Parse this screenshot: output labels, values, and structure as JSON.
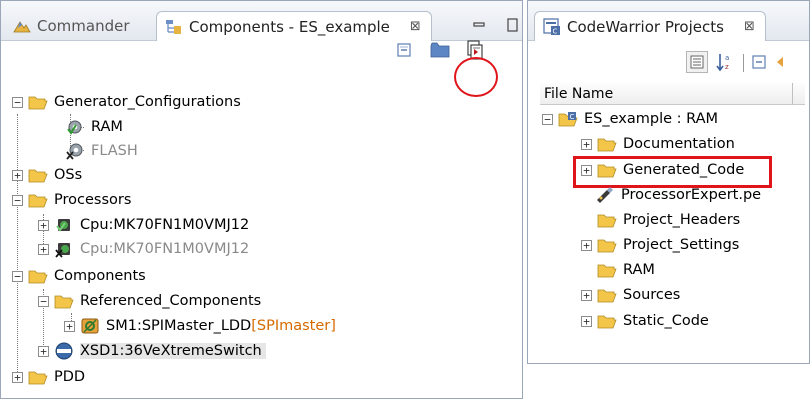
{
  "left_view": {
    "tabs": [
      {
        "label": "Commander",
        "active": false
      },
      {
        "label": "Components - ES_example",
        "active": true
      }
    ],
    "close_glyph": "⊠"
  },
  "right_view": {
    "tab": {
      "label": "CodeWarrior Projects",
      "active": true
    },
    "close_glyph": "⊠",
    "column_header": "File Name"
  },
  "components_tree": [
    {
      "label": "Generator_Configurations",
      "icon": "folder-icon",
      "expander": "−"
    },
    {
      "label": "RAM",
      "icon": "gear-check-icon"
    },
    {
      "label": "FLASH",
      "icon": "gear-x-icon",
      "muted": true
    },
    {
      "label": "OSs",
      "icon": "folder-icon",
      "expander": "+"
    },
    {
      "label": "Processors",
      "icon": "folder-icon",
      "expander": "−"
    },
    {
      "label": "Cpu:MK70FN1M0VMJ12",
      "icon": "cpu-check-icon",
      "expander": "+"
    },
    {
      "label": "Cpu:MK70FN1M0VMJ12",
      "icon": "cpu-x-icon",
      "expander": "+",
      "muted": true
    },
    {
      "label": "Components",
      "icon": "folder-icon",
      "expander": "−"
    },
    {
      "label": "Referenced_Components",
      "icon": "folder-icon",
      "expander": "−"
    },
    {
      "label": "SM1:SPIMaster_LDD",
      "suffix": "[SPImaster]",
      "icon": "component-icon",
      "expander": "+"
    },
    {
      "label": "XSD1:36VeXtremeSwitch",
      "icon": "user-component-icon",
      "expander": "+",
      "selected": true
    },
    {
      "label": "PDD",
      "icon": "folder-icon",
      "expander": "+"
    }
  ],
  "project_tree": [
    {
      "label": "ES_example : RAM",
      "icon": "project-icon",
      "expander": "−"
    },
    {
      "label": "Documentation",
      "icon": "folder-icon",
      "expander": "+"
    },
    {
      "label": "Generated_Code",
      "icon": "folder-icon",
      "expander": "+",
      "highlighted": true
    },
    {
      "label": "ProcessorExpert.pe",
      "icon": "pe-file-icon"
    },
    {
      "label": "Project_Headers",
      "icon": "folder-icon"
    },
    {
      "label": "Project_Settings",
      "icon": "folder-icon",
      "expander": "+"
    },
    {
      "label": "RAM",
      "icon": "folder-icon"
    },
    {
      "label": "Sources",
      "icon": "folder-icon",
      "expander": "+"
    },
    {
      "label": "Static_Code",
      "icon": "folder-icon",
      "expander": "+"
    }
  ],
  "colors": {
    "highlight": "#e0141b",
    "folder": "#f3c64a",
    "accent_text": "#d66a00",
    "selection": "#e6e6e6"
  }
}
